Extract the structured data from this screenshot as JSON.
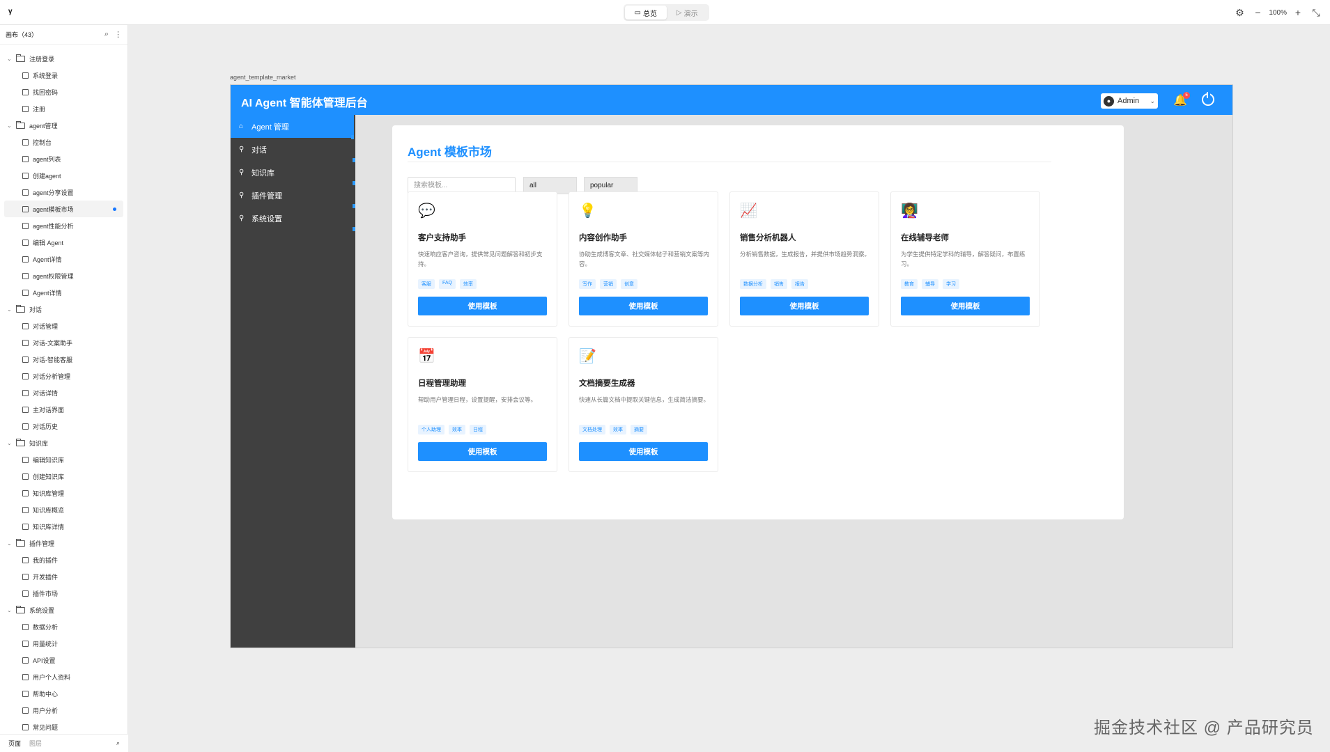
{
  "toolbar": {
    "logo": "ᵞ",
    "modes": [
      {
        "label": "总览",
        "active": true
      },
      {
        "label": "演示",
        "active": false
      }
    ],
    "zoom": "100%"
  },
  "left_panel": {
    "header": "画布（43）",
    "tree": [
      {
        "type": "group",
        "label": "注册登录"
      },
      {
        "type": "leaf",
        "label": "系统登录"
      },
      {
        "type": "leaf",
        "label": "找回密码"
      },
      {
        "type": "leaf",
        "label": "注册"
      },
      {
        "type": "group",
        "label": "agent管理"
      },
      {
        "type": "leaf",
        "label": "控制台"
      },
      {
        "type": "leaf",
        "label": "agent列表"
      },
      {
        "type": "leaf",
        "label": "创建agent"
      },
      {
        "type": "leaf",
        "label": "agent分享设置"
      },
      {
        "type": "leaf",
        "label": "agent模板市场",
        "selected": true
      },
      {
        "type": "leaf",
        "label": "agent性能分析"
      },
      {
        "type": "leaf",
        "label": "编辑 Agent"
      },
      {
        "type": "leaf",
        "label": "Agent详情"
      },
      {
        "type": "leaf",
        "label": "agent权限管理"
      },
      {
        "type": "leaf",
        "label": "Agent详情"
      },
      {
        "type": "group",
        "label": "对话"
      },
      {
        "type": "leaf",
        "label": "对话管理"
      },
      {
        "type": "leaf",
        "label": "对话-文案助手"
      },
      {
        "type": "leaf",
        "label": "对话-智能客服"
      },
      {
        "type": "leaf",
        "label": "对话分析管理"
      },
      {
        "type": "leaf",
        "label": "对话详情"
      },
      {
        "type": "leaf",
        "label": "主对话界面"
      },
      {
        "type": "leaf",
        "label": "对话历史"
      },
      {
        "type": "group",
        "label": "知识库"
      },
      {
        "type": "leaf",
        "label": "编辑知识库"
      },
      {
        "type": "leaf",
        "label": "创建知识库"
      },
      {
        "type": "leaf",
        "label": "知识库管理"
      },
      {
        "type": "leaf",
        "label": "知识库概览"
      },
      {
        "type": "leaf",
        "label": "知识库详情"
      },
      {
        "type": "group",
        "label": "插件管理"
      },
      {
        "type": "leaf",
        "label": "我的插件"
      },
      {
        "type": "leaf",
        "label": "开发插件"
      },
      {
        "type": "leaf",
        "label": "插件市场"
      },
      {
        "type": "group",
        "label": "系统设置"
      },
      {
        "type": "leaf",
        "label": "数据分析"
      },
      {
        "type": "leaf",
        "label": "用量统计"
      },
      {
        "type": "leaf",
        "label": "API设置"
      },
      {
        "type": "leaf",
        "label": "用户个人资料"
      },
      {
        "type": "leaf",
        "label": "帮助中心"
      },
      {
        "type": "leaf",
        "label": "用户分析"
      },
      {
        "type": "leaf",
        "label": "常见问题"
      }
    ],
    "footer": {
      "pages": "页面",
      "layers": "图层"
    }
  },
  "frame": {
    "label": "agent_template_market",
    "app_title": "AI Agent 智能体管理后台",
    "user": "Admin",
    "notif_count": "5",
    "nav": [
      {
        "label": "Agent 管理",
        "active": true
      },
      {
        "label": "对话",
        "active": false
      },
      {
        "label": "知识库",
        "active": false
      },
      {
        "label": "插件管理",
        "active": false
      },
      {
        "label": "系统设置",
        "active": false
      }
    ],
    "panel": {
      "title": "Agent 模板市场",
      "search_placeholder": "搜索模板...",
      "category": "all",
      "sort": "popular",
      "use_label": "使用模板",
      "cards": [
        {
          "icon": "💬",
          "icon_name": "chat-bubble-icon",
          "name": "客户支持助手",
          "desc": "快速响应客户咨询，提供常见问题解答和初步支持。",
          "tags": [
            "客服",
            "FAQ",
            "效率"
          ]
        },
        {
          "icon": "💡",
          "icon_name": "lightbulb-icon",
          "name": "内容创作助手",
          "desc": "协助生成博客文章、社交媒体帖子和营销文案等内容。",
          "tags": [
            "写作",
            "营销",
            "创意"
          ]
        },
        {
          "icon": "📈",
          "icon_name": "chart-up-icon",
          "name": "销售分析机器人",
          "desc": "分析销售数据，生成报告，并提供市场趋势洞察。",
          "tags": [
            "数据分析",
            "销售",
            "报告"
          ]
        },
        {
          "icon": "👩‍🏫",
          "icon_name": "teacher-icon",
          "name": "在线辅导老师",
          "desc": "为学生提供特定学科的辅导，解答疑问，布置练习。",
          "tags": [
            "教育",
            "辅导",
            "学习"
          ]
        },
        {
          "icon": "📅",
          "icon_name": "calendar-icon",
          "name": "日程管理助理",
          "desc": "帮助用户管理日程，设置提醒，安排会议等。",
          "tags": [
            "个人助理",
            "效率",
            "日程"
          ]
        },
        {
          "icon": "📝",
          "icon_name": "memo-icon",
          "name": "文档摘要生成器",
          "desc": "快速从长篇文档中提取关键信息，生成简洁摘要。",
          "tags": [
            "文档处理",
            "效率",
            "摘要"
          ]
        }
      ]
    }
  },
  "watermark": "掘金技术社区 @ 产品研究员"
}
